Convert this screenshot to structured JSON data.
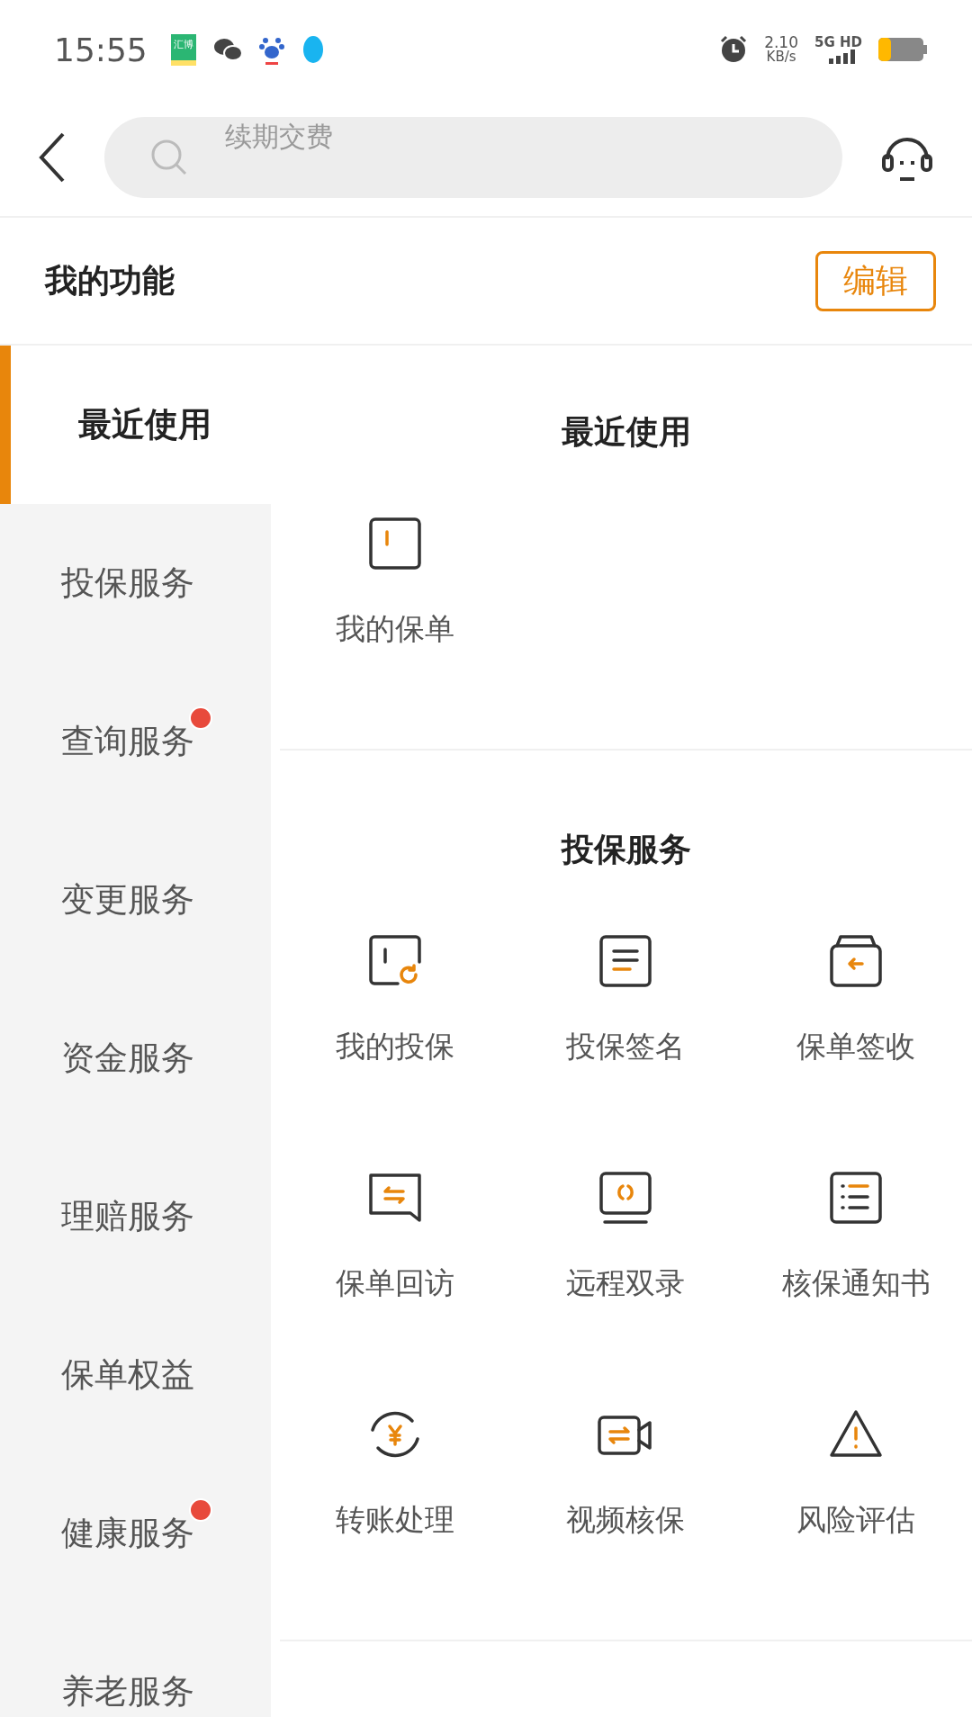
{
  "status_bar": {
    "time": "15:55",
    "app_badge": "汇博",
    "speed": "2.10",
    "speed_unit": "KB/s",
    "network": "5G",
    "hd": "HD"
  },
  "search": {
    "placeholder": "续期交费"
  },
  "my_functions": {
    "title": "我的功能",
    "edit_button": "编辑"
  },
  "sidebar": {
    "items": [
      {
        "label": "最近使用",
        "selected": true,
        "badge": false
      },
      {
        "label": "投保服务",
        "selected": false,
        "badge": false
      },
      {
        "label": "查询服务",
        "selected": false,
        "badge": true
      },
      {
        "label": "变更服务",
        "selected": false,
        "badge": false
      },
      {
        "label": "资金服务",
        "selected": false,
        "badge": false
      },
      {
        "label": "理赔服务",
        "selected": false,
        "badge": false
      },
      {
        "label": "保单权益",
        "selected": false,
        "badge": false
      },
      {
        "label": "健康服务",
        "selected": false,
        "badge": true
      },
      {
        "label": "养老服务",
        "selected": false,
        "badge": false
      }
    ]
  },
  "sections": [
    {
      "title": "最近使用",
      "items": [
        {
          "label": "我的保单",
          "kind": "policy"
        }
      ]
    },
    {
      "title": "投保服务",
      "items": [
        {
          "label": "我的投保",
          "kind": "renew"
        },
        {
          "label": "投保签名",
          "kind": "document"
        },
        {
          "label": "保单签收",
          "kind": "inbox"
        },
        {
          "label": "保单回访",
          "kind": "chat"
        },
        {
          "label": "远程双录",
          "kind": "monitor"
        },
        {
          "label": "核保通知书",
          "kind": "list"
        },
        {
          "label": "转账处理",
          "kind": "yuan"
        },
        {
          "label": "视频核保",
          "kind": "video"
        },
        {
          "label": "风险评估",
          "kind": "warning"
        }
      ]
    }
  ]
}
